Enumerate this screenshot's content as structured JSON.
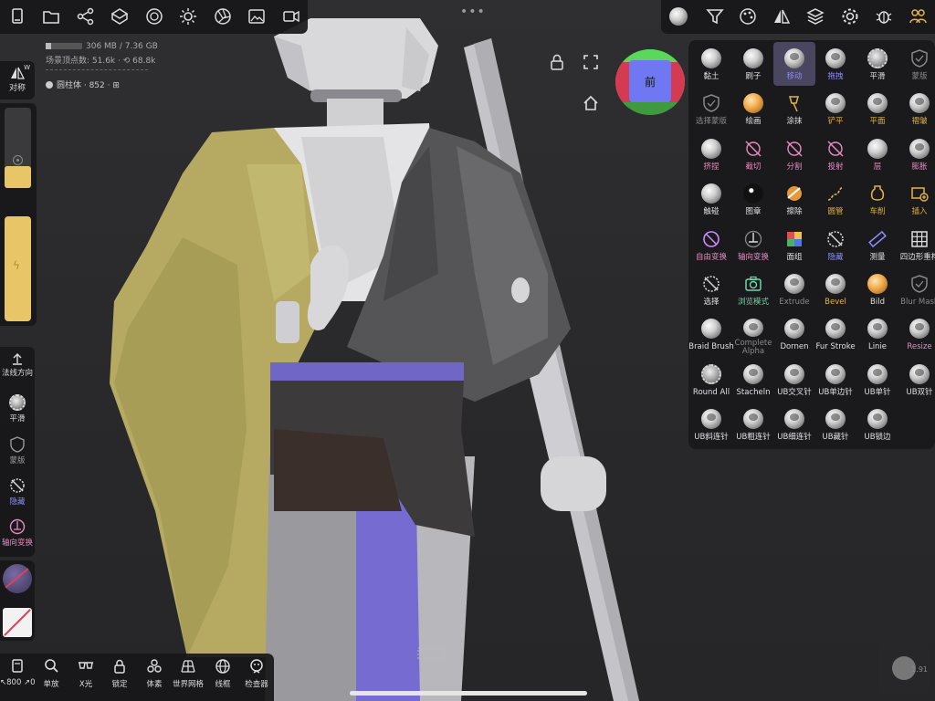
{
  "top_left_toolbar": [
    "folder-icon",
    "file-icon",
    "share-nodes-icon",
    "scene-icon",
    "texture-icon",
    "light-icon",
    "aperture-icon",
    "image-icon",
    "video-icon"
  ],
  "info": {
    "memory": "306 MB / 7.36 GB",
    "vertex_count": "场景顶点数: 51.6k · ⟲ 68.8k",
    "object_label": "圆柱体 · 852 · ⊞"
  },
  "symmetry": {
    "label": "对称",
    "badge": "W"
  },
  "left_tools": {
    "normal_dir": "法线方向",
    "smooth": "平滑",
    "mask": "蒙版",
    "hide": "隐藏",
    "axis_transform": "轴向变换"
  },
  "view": {
    "cube_label": "前"
  },
  "bottom_bar": {
    "items": [
      {
        "icon": "status-icon",
        "label": "↖800 ↗0"
      },
      {
        "icon": "zoom-icon",
        "label": "单放"
      },
      {
        "icon": "xray-icon",
        "label": "X光"
      },
      {
        "icon": "lock-icon",
        "label": "锁定"
      },
      {
        "icon": "voxel-icon",
        "label": "体素"
      },
      {
        "icon": "grid-icon",
        "label": "世界网格"
      },
      {
        "icon": "wireframe-icon",
        "label": "线框"
      },
      {
        "icon": "inspector-icon",
        "label": "检查器"
      }
    ]
  },
  "bottom_right": {
    "value": "1.91"
  },
  "brushes": [
    [
      "黏土",
      "刷子",
      "移动",
      "拖拽",
      "平滑",
      "蒙版"
    ],
    [
      "选择蒙版",
      "绘画",
      "涂抹",
      "铲平",
      "平面",
      "褶皱"
    ],
    [
      "挤捏",
      "截切",
      "分割",
      "投射",
      "层",
      "膨胀"
    ],
    [
      "触碰",
      "图章",
      "擦除",
      "圆管",
      "车削",
      "插入"
    ],
    [
      "自由变换",
      "轴向变换",
      "面组",
      "隐藏",
      "测量",
      "四边形重构"
    ],
    [
      "选择",
      "浏览模式",
      "Extrude",
      "Bevel",
      "Bild",
      "Blur Mask"
    ],
    [
      "Braid Brush",
      "Complete Alpha",
      "Dornen",
      "Fur Stroke",
      "Linie",
      "Resize"
    ],
    [
      "Round All",
      "Stacheln",
      "UB交叉针",
      "UB单边针",
      "UB单针",
      "UB双针"
    ],
    [
      "UB斜连针",
      "UB粗连针",
      "UB细连针",
      "UB藏针",
      "UB锁边"
    ]
  ],
  "colors": {
    "panel": "#1b1b1d",
    "selected": "#4a4660",
    "pink": "#e78bc0",
    "gold": "#e3b34c",
    "slider": "#e8c566",
    "purple_belt": "#6d63c2"
  }
}
